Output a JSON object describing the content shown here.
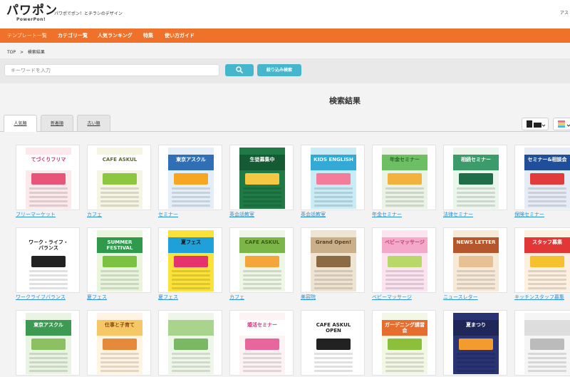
{
  "header": {
    "logo_main": "パワポン",
    "logo_sub": "PowerPon!",
    "tagline": "パワポでポン！とチラシのデザイン",
    "top_right": "アス"
  },
  "nav": {
    "items": [
      {
        "label": "テンプレート一覧"
      },
      {
        "label": "カテゴリ一覧"
      },
      {
        "label": "人気ランキング"
      },
      {
        "label": "特集"
      },
      {
        "label": "使い方ガイド"
      }
    ]
  },
  "breadcrumb": {
    "home": "TOP",
    "separator": ">",
    "current": "検索結果"
  },
  "search": {
    "placeholder": "キーワードを入力",
    "button_icon": "search-icon",
    "filter_label": "絞り込み検索"
  },
  "results": {
    "title": "検索結果",
    "tabs": [
      {
        "label": "人気順",
        "active": true
      },
      {
        "label": "新着順",
        "active": false
      },
      {
        "label": "古い順",
        "active": false
      }
    ]
  },
  "colors": {
    "nav_bg": "#f0712a",
    "accent": "#45b6cc",
    "link": "#2a8fd8"
  },
  "templates": [
    {
      "label": "フリーマーケット",
      "title": "てづくりフリマ",
      "bg": "#fbe9ec",
      "band": "#ffffff",
      "accent": "#e7557a",
      "text": "#d6336c"
    },
    {
      "label": "カフェ",
      "title": "CAFE ASKUL",
      "bg": "#f6f4e2",
      "band": "#ffffff",
      "accent": "#8dc63f",
      "text": "#5a6b2a"
    },
    {
      "label": "セミナー",
      "title": "東京アスクル",
      "bg": "#e4eef9",
      "band": "#2f6fb6",
      "accent": "#f5a623",
      "text": "#ffffff"
    },
    {
      "label": "英会話教室",
      "title": "生徒募集中",
      "bg": "#1f7a45",
      "band": "#145a33",
      "accent": "#f4c842",
      "text": "#ffffff"
    },
    {
      "label": "英会話教室",
      "title": "KIDS ENGLISH",
      "bg": "#c8ebf5",
      "band": "#35a9d6",
      "accent": "#f47c9b",
      "text": "#ffffff"
    },
    {
      "label": "年金セミナー",
      "title": "年金セミナー",
      "bg": "#eaf3e5",
      "band": "#6cbf63",
      "accent": "#f3b13d",
      "text": "#2d6a2a"
    },
    {
      "label": "法律セミナー",
      "title": "相続セミナー",
      "bg": "#eaf5ec",
      "band": "#3b9b6a",
      "accent": "#1f6e49",
      "text": "#ffffff"
    },
    {
      "label": "保険セミナー",
      "title": "セミナー&相談会",
      "bg": "#e6ecf6",
      "band": "#1f4f9a",
      "accent": "#e23b3b",
      "text": "#ffffff"
    },
    {
      "label": "ワークライフバランス",
      "title": "ワーク・ライフ・バランス",
      "bg": "#ffffff",
      "band": "#ffffff",
      "accent": "#222222",
      "text": "#222222"
    },
    {
      "label": "夏フェス",
      "title": "SUMMER FESTIVAL",
      "bg": "#e9f6dd",
      "band": "#2f9a4b",
      "accent": "#7cc242",
      "text": "#ffffff"
    },
    {
      "label": "夏フェス",
      "title": "夏フェス",
      "bg": "#fbe23a",
      "band": "#20a0d8",
      "accent": "#e7336b",
      "text": "#111111"
    },
    {
      "label": "カフェ",
      "title": "CAFE ASKUL",
      "bg": "#eef6e6",
      "band": "#7cb548",
      "accent": "#f4a63a",
      "text": "#3c5a1c"
    },
    {
      "label": "美容院",
      "title": "Grand Open!",
      "bg": "#efe4d2",
      "band": "#c9b08a",
      "accent": "#8a6b43",
      "text": "#5a4327"
    },
    {
      "label": "ベビーマッサージ",
      "title": "ベビーマッサージ",
      "bg": "#fbe4ef",
      "band": "#f3a9c7",
      "accent": "#b9d86a",
      "text": "#c2417a"
    },
    {
      "label": "ニュースレター",
      "title": "NEWS LETTER",
      "bg": "#f6e9d8",
      "band": "#b5562c",
      "accent": "#e7c193",
      "text": "#ffffff"
    },
    {
      "label": "キッチンスタッフ募集",
      "title": "スタッフ募集",
      "bg": "#fdf0e0",
      "band": "#e13737",
      "accent": "#f5c12e",
      "text": "#ffffff"
    },
    {
      "label": "",
      "title": "東京アスクル",
      "bg": "#e9f4e3",
      "band": "#3c9a53",
      "accent": "#8cc063",
      "text": "#ffffff"
    },
    {
      "label": "",
      "title": "仕事と子育て",
      "bg": "#fff4e2",
      "band": "#f6c765",
      "accent": "#e58a3a",
      "text": "#8a4b10"
    },
    {
      "label": "",
      "title": "",
      "bg": "#eef6e9",
      "band": "#a9d48d",
      "accent": "#7ab863",
      "text": "#3d6c2c"
    },
    {
      "label": "",
      "title": "婚活セミナー",
      "bg": "#fdf3f5",
      "band": "#ffffff",
      "accent": "#e8669c",
      "text": "#c33a74"
    },
    {
      "label": "",
      "title": "CAFE ASKUL OPEN",
      "bg": "#ffffff",
      "band": "#ffffff",
      "accent": "#222222",
      "text": "#222222"
    },
    {
      "label": "",
      "title": "ガーデニング講習会",
      "bg": "#f3f8e6",
      "band": "#e66d2d",
      "accent": "#8cbf3a",
      "text": "#ffffff"
    },
    {
      "label": "",
      "title": "夏まつり",
      "bg": "#2a3474",
      "band": "#1f2759",
      "accent": "#f39c2d",
      "text": "#ffffff"
    },
    {
      "label": "",
      "title": "",
      "bg": "#f5f5f5",
      "band": "#dddddd",
      "accent": "#bbbbbb",
      "text": "#333333"
    }
  ]
}
